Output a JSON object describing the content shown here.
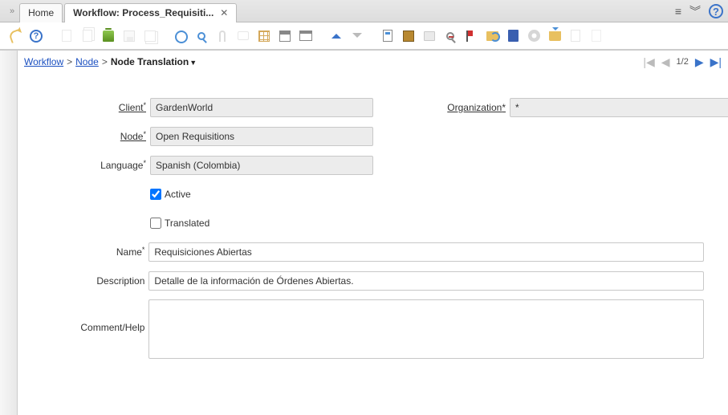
{
  "tabs": {
    "home": "Home",
    "active": "Workflow: Process_Requisiti..."
  },
  "breadcrumb": {
    "workflow": "Workflow",
    "node": "Node",
    "current": "Node Translation"
  },
  "pager": {
    "text": "1/2"
  },
  "form": {
    "client_label": "Client",
    "client_value": "GardenWorld",
    "org_label": "Organization",
    "org_value": "*",
    "node_label": "Node",
    "node_value": "Open Requisitions",
    "language_label": "Language",
    "language_value": "Spanish (Colombia)",
    "active_label": "Active",
    "translated_label": "Translated",
    "name_label": "Name",
    "name_value": "Requisiciones Abiertas",
    "description_label": "Description",
    "description_value": "Detalle de la información de Órdenes Abiertas.",
    "comment_label": "Comment/Help",
    "comment_value": ""
  }
}
